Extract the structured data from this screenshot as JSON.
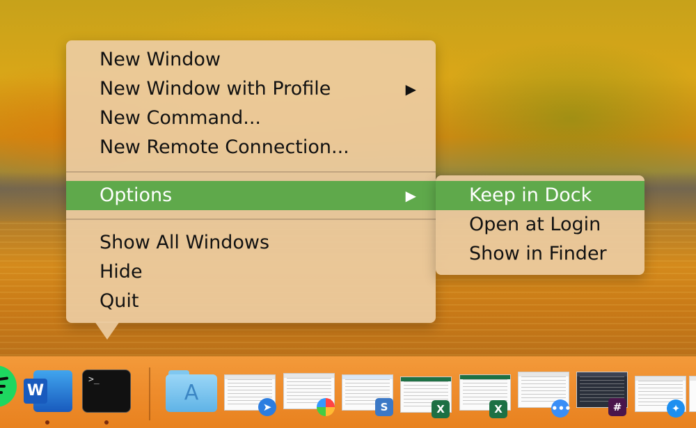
{
  "context_menu": {
    "items": [
      {
        "label": "New Window"
      },
      {
        "label": "New Window with Profile",
        "arrow": "▶"
      },
      {
        "label": "New Command..."
      },
      {
        "label": "New Remote Connection..."
      },
      {
        "label": "Options",
        "arrow": "▶",
        "highlighted": true
      },
      {
        "label": "Show All Windows"
      },
      {
        "label": "Hide"
      },
      {
        "label": "Quit"
      }
    ]
  },
  "options_submenu": {
    "items": [
      {
        "label": "Keep in Dock",
        "highlighted": true
      },
      {
        "label": "Open at Login"
      },
      {
        "label": "Show in Finder"
      }
    ]
  },
  "dock": {
    "apps": [
      {
        "name": "spotify-icon"
      },
      {
        "name": "microsoft-word-icon",
        "letter": "W",
        "running": true
      },
      {
        "name": "terminal-icon",
        "prompt": ">_",
        "running": true
      },
      {
        "name": "applications-folder-icon",
        "glyph": "A"
      },
      {
        "name": "window-thumbnail",
        "badge": "spark-mail"
      },
      {
        "name": "window-thumbnail",
        "badge": "photos"
      },
      {
        "name": "window-thumbnail",
        "badge": "s",
        "badge_text": "S"
      },
      {
        "name": "window-thumbnail",
        "badge": "excel",
        "badge_text": "X"
      },
      {
        "name": "window-thumbnail",
        "badge": "excel",
        "badge_text": "X"
      },
      {
        "name": "window-thumbnail",
        "badge": "messages"
      },
      {
        "name": "window-thumbnail",
        "badge": "slack"
      },
      {
        "name": "window-thumbnail",
        "badge": "safari"
      }
    ]
  },
  "colors": {
    "highlight": "#5fa94b",
    "menu_background": "#eccba0",
    "dock_background": "#ee8c2c"
  }
}
